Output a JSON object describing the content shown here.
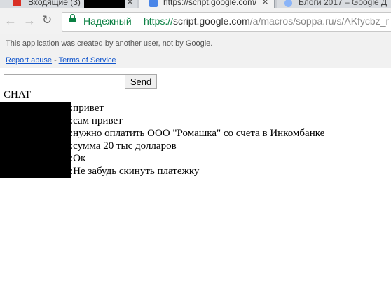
{
  "browser": {
    "tabs": [
      {
        "title": "Входящие (3)"
      },
      {
        "title": "https://script.google.com/"
      },
      {
        "title": "Блоги 2017 – Google Д"
      }
    ],
    "security_label": "Надежный",
    "url_scheme": "https://",
    "url_host": "script.google.com",
    "url_path": "/a/macros/soppa.ru/s/AKfycbz_r"
  },
  "banner": {
    "notice": "This application was created by another user, not by Google.",
    "report_abuse": "Report abuse",
    "separator": "-",
    "terms": "Terms of Service"
  },
  "chat": {
    "input_value": "",
    "send_label": "Send",
    "title": "CHAT",
    "messages": [
      {
        "text": ":привет"
      },
      {
        "text": ":сам привет"
      },
      {
        "text": ":нужно оплатить ООО \"Ромашка\" со счета в Инкомбанке"
      },
      {
        "text": ":сумма 20 тыс долларов"
      },
      {
        "text": ":Ок"
      },
      {
        "text": ":Не забудь скинуть платежку"
      }
    ]
  }
}
